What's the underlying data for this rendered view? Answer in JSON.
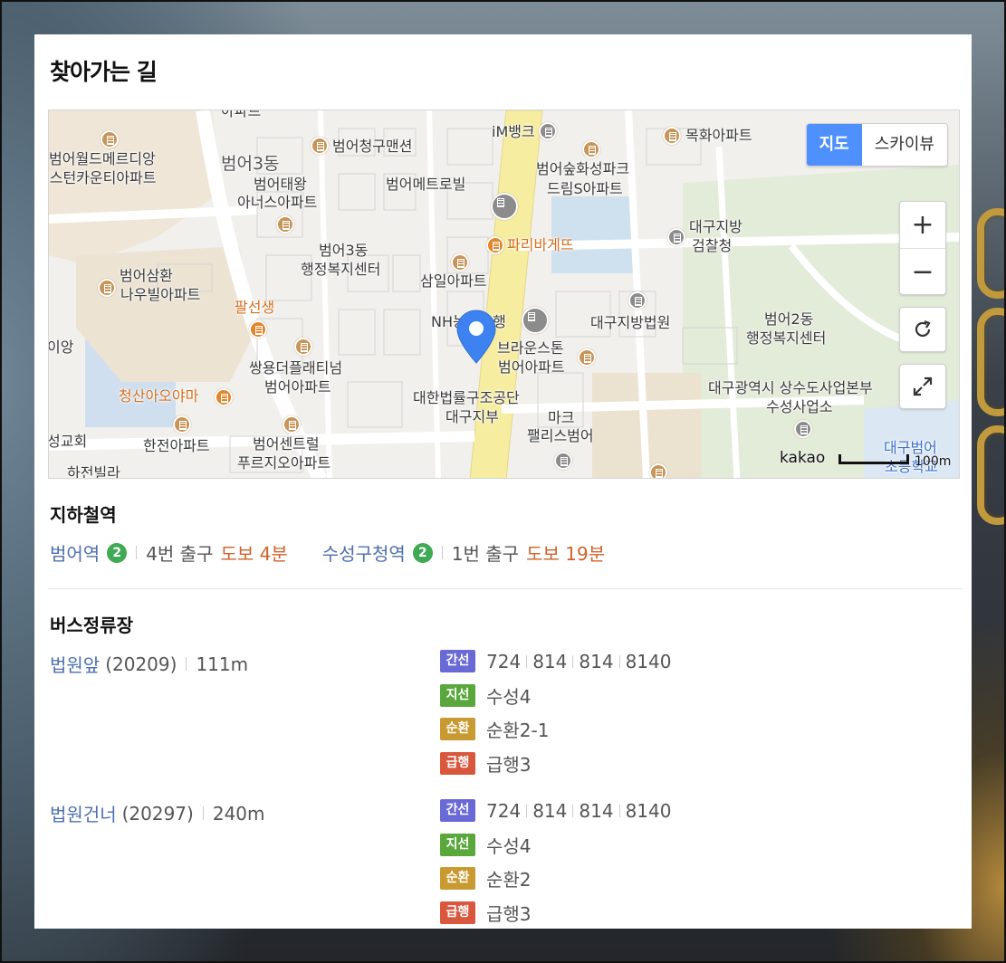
{
  "page": {
    "title": "찾아가는 길"
  },
  "map": {
    "toggle": {
      "map_label": "지도",
      "skyview_label": "스카이뷰",
      "active": "지도"
    },
    "zoom_in": "+",
    "zoom_out": "−",
    "provider": "kakao",
    "scale_label": "100m",
    "labels": {
      "l1": "아파트",
      "l2": "범어월드메르디앙",
      "l3": "웨스턴카운티아파트",
      "l4": "범어3동",
      "l5": "범어청구맨션",
      "l6": "iM뱅크",
      "l7": "목화아파트",
      "l8": "범어태왕",
      "l9": "아너스아파트",
      "l10": "범어메트로빌",
      "l11": "범어숲화성파크",
      "l12": "드림S아파트",
      "l13": "대구지방",
      "l14": "검찰청",
      "l15": "범어3동",
      "l16": "행정복지센터",
      "l17": "파리바게뜨",
      "l18": "범어삼환",
      "l19": "나우빌아파트",
      "l20": "삼일아파트",
      "l21": "팔선생",
      "l22": "NH농협은행",
      "l23": "대구지방법원",
      "l24": "범어2동",
      "l25": "행정복지센터",
      "l26": "이앙",
      "l27": "브라운스톤",
      "l28": "범어아파트",
      "l29": "쌍용더플래티넘",
      "l30": "범어아파트",
      "l31": "청산아오야마",
      "l32": "대한법률구조공단",
      "l33": "대구지부",
      "l34": "대구광역시 상수도사업본부",
      "l35": "수성사업소",
      "l36": "마크",
      "l37": "팰리스범어",
      "l38": "성교회",
      "l39": "한전아파트",
      "l40": "범어센트럴",
      "l41": "푸르지오아파트",
      "l42": "대구범어",
      "l43": "초등학교",
      "l44": "하전빌라"
    }
  },
  "subway": {
    "section_title": "지하철역",
    "stations": [
      {
        "name": "범어역",
        "line": "2",
        "exit": "4번 출구",
        "walk": "도보 4분"
      },
      {
        "name": "수성구청역",
        "line": "2",
        "exit": "1번 출구",
        "walk": "도보 19분"
      }
    ]
  },
  "bus": {
    "section_title": "버스정류장",
    "stops": [
      {
        "name": "법원앞",
        "code": "(20209)",
        "distance": "111m",
        "routes": [
          {
            "type": "간선",
            "numbers": [
              "724",
              "814",
              "814",
              "8140"
            ]
          },
          {
            "type": "지선",
            "numbers": [
              "수성4"
            ]
          },
          {
            "type": "순환",
            "numbers": [
              "순환2-1"
            ]
          },
          {
            "type": "급행",
            "numbers": [
              "급행3"
            ]
          }
        ]
      },
      {
        "name": "법원건너",
        "code": "(20297)",
        "distance": "240m",
        "routes": [
          {
            "type": "간선",
            "numbers": [
              "724",
              "814",
              "814",
              "8140"
            ]
          },
          {
            "type": "지선",
            "numbers": [
              "수성4"
            ]
          },
          {
            "type": "순환",
            "numbers": [
              "순환2"
            ]
          },
          {
            "type": "급행",
            "numbers": [
              "급행3"
            ]
          }
        ]
      }
    ]
  },
  "colors": {
    "link": "#4d6fb0",
    "walk": "#d0612a",
    "line2": "#3fa953",
    "trunk": "#6a6ad6",
    "branch": "#5aa83c",
    "circular": "#c99a31",
    "express": "#d9573c",
    "map_toggle_active": "#4d90fe",
    "pin": "#3d82f0"
  }
}
